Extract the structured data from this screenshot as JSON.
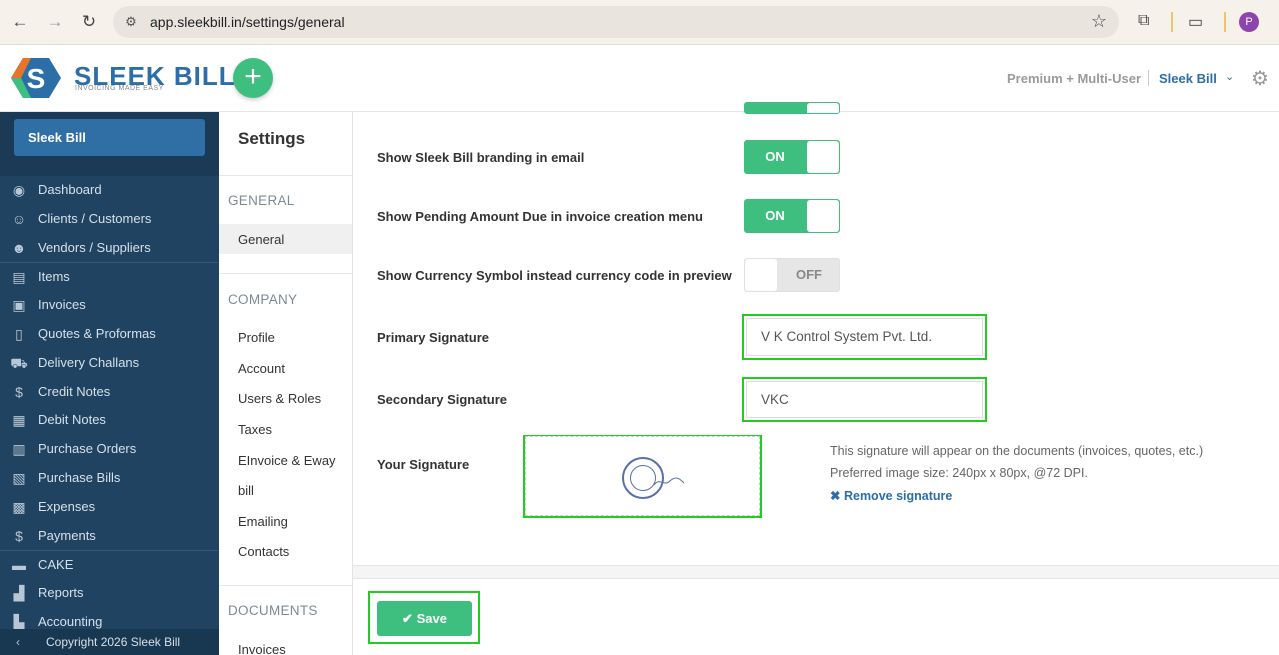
{
  "browser": {
    "url": "app.sleekbill.in/settings/general",
    "profile_initial": "P"
  },
  "header": {
    "logo_title": "SLEEK BILL",
    "logo_tagline": "INVOICING MADE EASY",
    "add_label": "+",
    "plan": "Premium + Multi-User",
    "company": "Sleek Bill"
  },
  "sidebar": {
    "company_button": "Sleek Bill",
    "items": [
      {
        "label": "Dashboard",
        "icon": "eye-icon",
        "glyph": "◉"
      },
      {
        "label": "Clients / Customers",
        "icon": "users-icon",
        "glyph": "☺"
      },
      {
        "label": "Vendors / Suppliers",
        "icon": "user-icon",
        "glyph": "☻"
      },
      {
        "label": "Items",
        "icon": "basket-icon",
        "glyph": "▤"
      },
      {
        "label": "Invoices",
        "icon": "invoice-icon",
        "glyph": "▣"
      },
      {
        "label": "Quotes & Proformas",
        "icon": "document-icon",
        "glyph": "▯"
      },
      {
        "label": "Delivery Challans",
        "icon": "truck-icon",
        "glyph": "⛟"
      },
      {
        "label": "Credit Notes",
        "icon": "dollar-doc-icon",
        "glyph": "$"
      },
      {
        "label": "Debit Notes",
        "icon": "debit-doc-icon",
        "glyph": "▦"
      },
      {
        "label": "Purchase Orders",
        "icon": "clipboard-icon",
        "glyph": "▥"
      },
      {
        "label": "Purchase Bills",
        "icon": "bill-icon",
        "glyph": "▧"
      },
      {
        "label": "Expenses",
        "icon": "calculator-icon",
        "glyph": "▩"
      },
      {
        "label": "Payments",
        "icon": "dollar-icon",
        "glyph": "$"
      },
      {
        "label": "CAKE",
        "icon": "cake-icon",
        "glyph": "▬"
      },
      {
        "label": "Reports",
        "icon": "chart-icon",
        "glyph": "▟"
      },
      {
        "label": "Accounting",
        "icon": "accounting-icon",
        "glyph": "▙"
      }
    ],
    "footer": "Copyright 2026 Sleek Bill"
  },
  "settings_menu": {
    "title": "Settings",
    "sections": {
      "general": "GENERAL",
      "company": "COMPANY",
      "documents": "DOCUMENTS"
    },
    "general_items": [
      "General"
    ],
    "company_items": [
      "Profile",
      "Account",
      "Users & Roles",
      "Taxes",
      "EInvoice & Eway",
      "bill",
      "Emailing",
      "Contacts"
    ],
    "document_items": [
      "Invoices"
    ]
  },
  "settings": {
    "branding_label": "Show Sleek Bill branding in email",
    "branding_state": "ON",
    "pending_label": "Show Pending Amount Due in invoice creation menu",
    "pending_state": "ON",
    "currency_label": "Show Currency Symbol instead currency code in preview",
    "currency_state": "OFF",
    "primary_sig_label": "Primary Signature",
    "primary_sig_value": "V K Control System Pvt. Ltd.",
    "secondary_sig_label": "Secondary Signature",
    "secondary_sig_value": "VKC",
    "your_sig_label": "Your Signature",
    "sig_info_1": "This signature will appear on the documents (invoices, quotes, etc.)",
    "sig_info_2": "Preferred image size: 240px x 80px, @72 DPI.",
    "remove_signature": "Remove signature",
    "save_label": "Save"
  },
  "colors": {
    "accent_green": "#3fbf7f",
    "sidebar_bg": "#1f4361",
    "brand_blue": "#2c6ea8",
    "highlight": "#22cc22"
  }
}
